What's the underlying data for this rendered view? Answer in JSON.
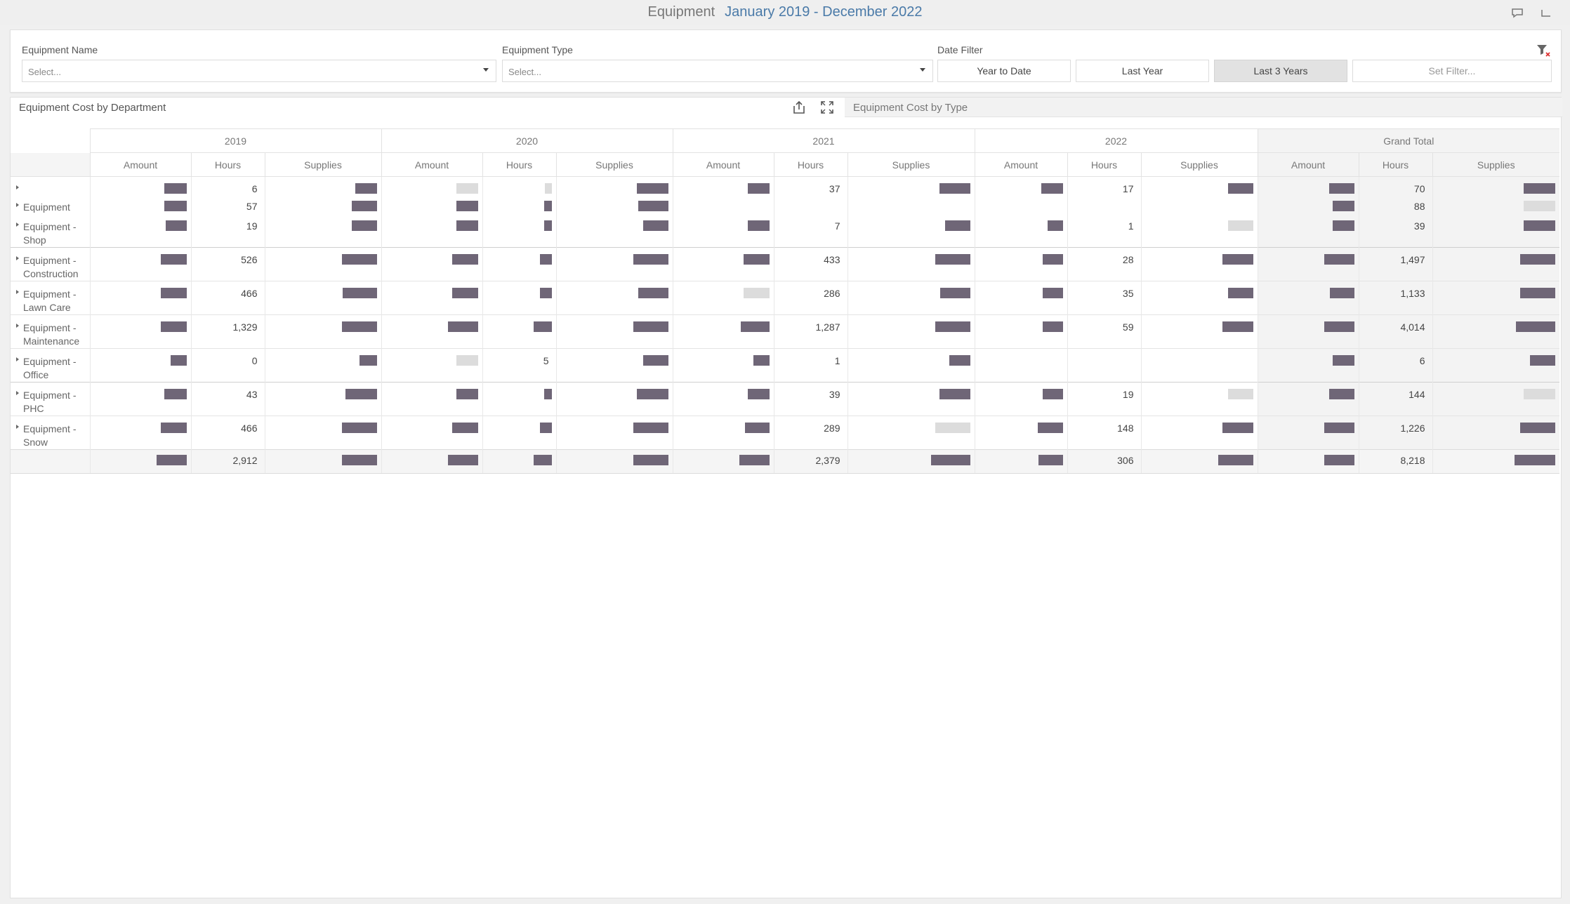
{
  "header": {
    "title": "Equipment",
    "range": "January 2019 - December 2022"
  },
  "filters": {
    "equipment_name": {
      "label": "Equipment Name",
      "placeholder": "Select..."
    },
    "equipment_type": {
      "label": "Equipment Type",
      "placeholder": "Select..."
    },
    "date_filter": {
      "label": "Date Filter",
      "options": [
        "Year to Date",
        "Last Year",
        "Last 3 Years",
        "Set Filter..."
      ],
      "selected": "Last 3 Years"
    }
  },
  "tabs": {
    "active": "Equipment Cost by Department",
    "inactive": "Equipment Cost by Type"
  },
  "pivot": {
    "years": [
      "2019",
      "2020",
      "2021",
      "2022",
      "Grand Total"
    ],
    "measures": [
      "Amount",
      "Hours",
      "Supplies"
    ],
    "rows": [
      {
        "label": "",
        "hours": [
          "6",
          "",
          "37",
          "17",
          "70"
        ]
      },
      {
        "label": "Equipment",
        "hours": [
          "57",
          "",
          "",
          "",
          "88"
        ]
      },
      {
        "label": "Equipment - Shop",
        "hours": [
          "19",
          "",
          "7",
          "1",
          "39"
        ]
      },
      {
        "label": "Equipment - Construction",
        "hours": [
          "526",
          "",
          "433",
          "28",
          "1,497"
        ]
      },
      {
        "label": "Equipment - Lawn Care",
        "hours": [
          "466",
          "",
          "286",
          "35",
          "1,133"
        ]
      },
      {
        "label": "Equipment - Maintenance",
        "hours": [
          "1,329",
          "",
          "1,287",
          "59",
          "4,014"
        ]
      },
      {
        "label": "Equipment - Office",
        "hours": [
          "0",
          "5",
          "1",
          "",
          "6"
        ]
      },
      {
        "label": "Equipment - PHC",
        "hours": [
          "43",
          "",
          "39",
          "19",
          "144"
        ]
      },
      {
        "label": "Equipment - Snow",
        "hours": [
          "466",
          "",
          "289",
          "148",
          "1,226"
        ]
      }
    ],
    "total": {
      "hours": [
        "2,912",
        "",
        "2,379",
        "306",
        "8,218"
      ]
    }
  }
}
